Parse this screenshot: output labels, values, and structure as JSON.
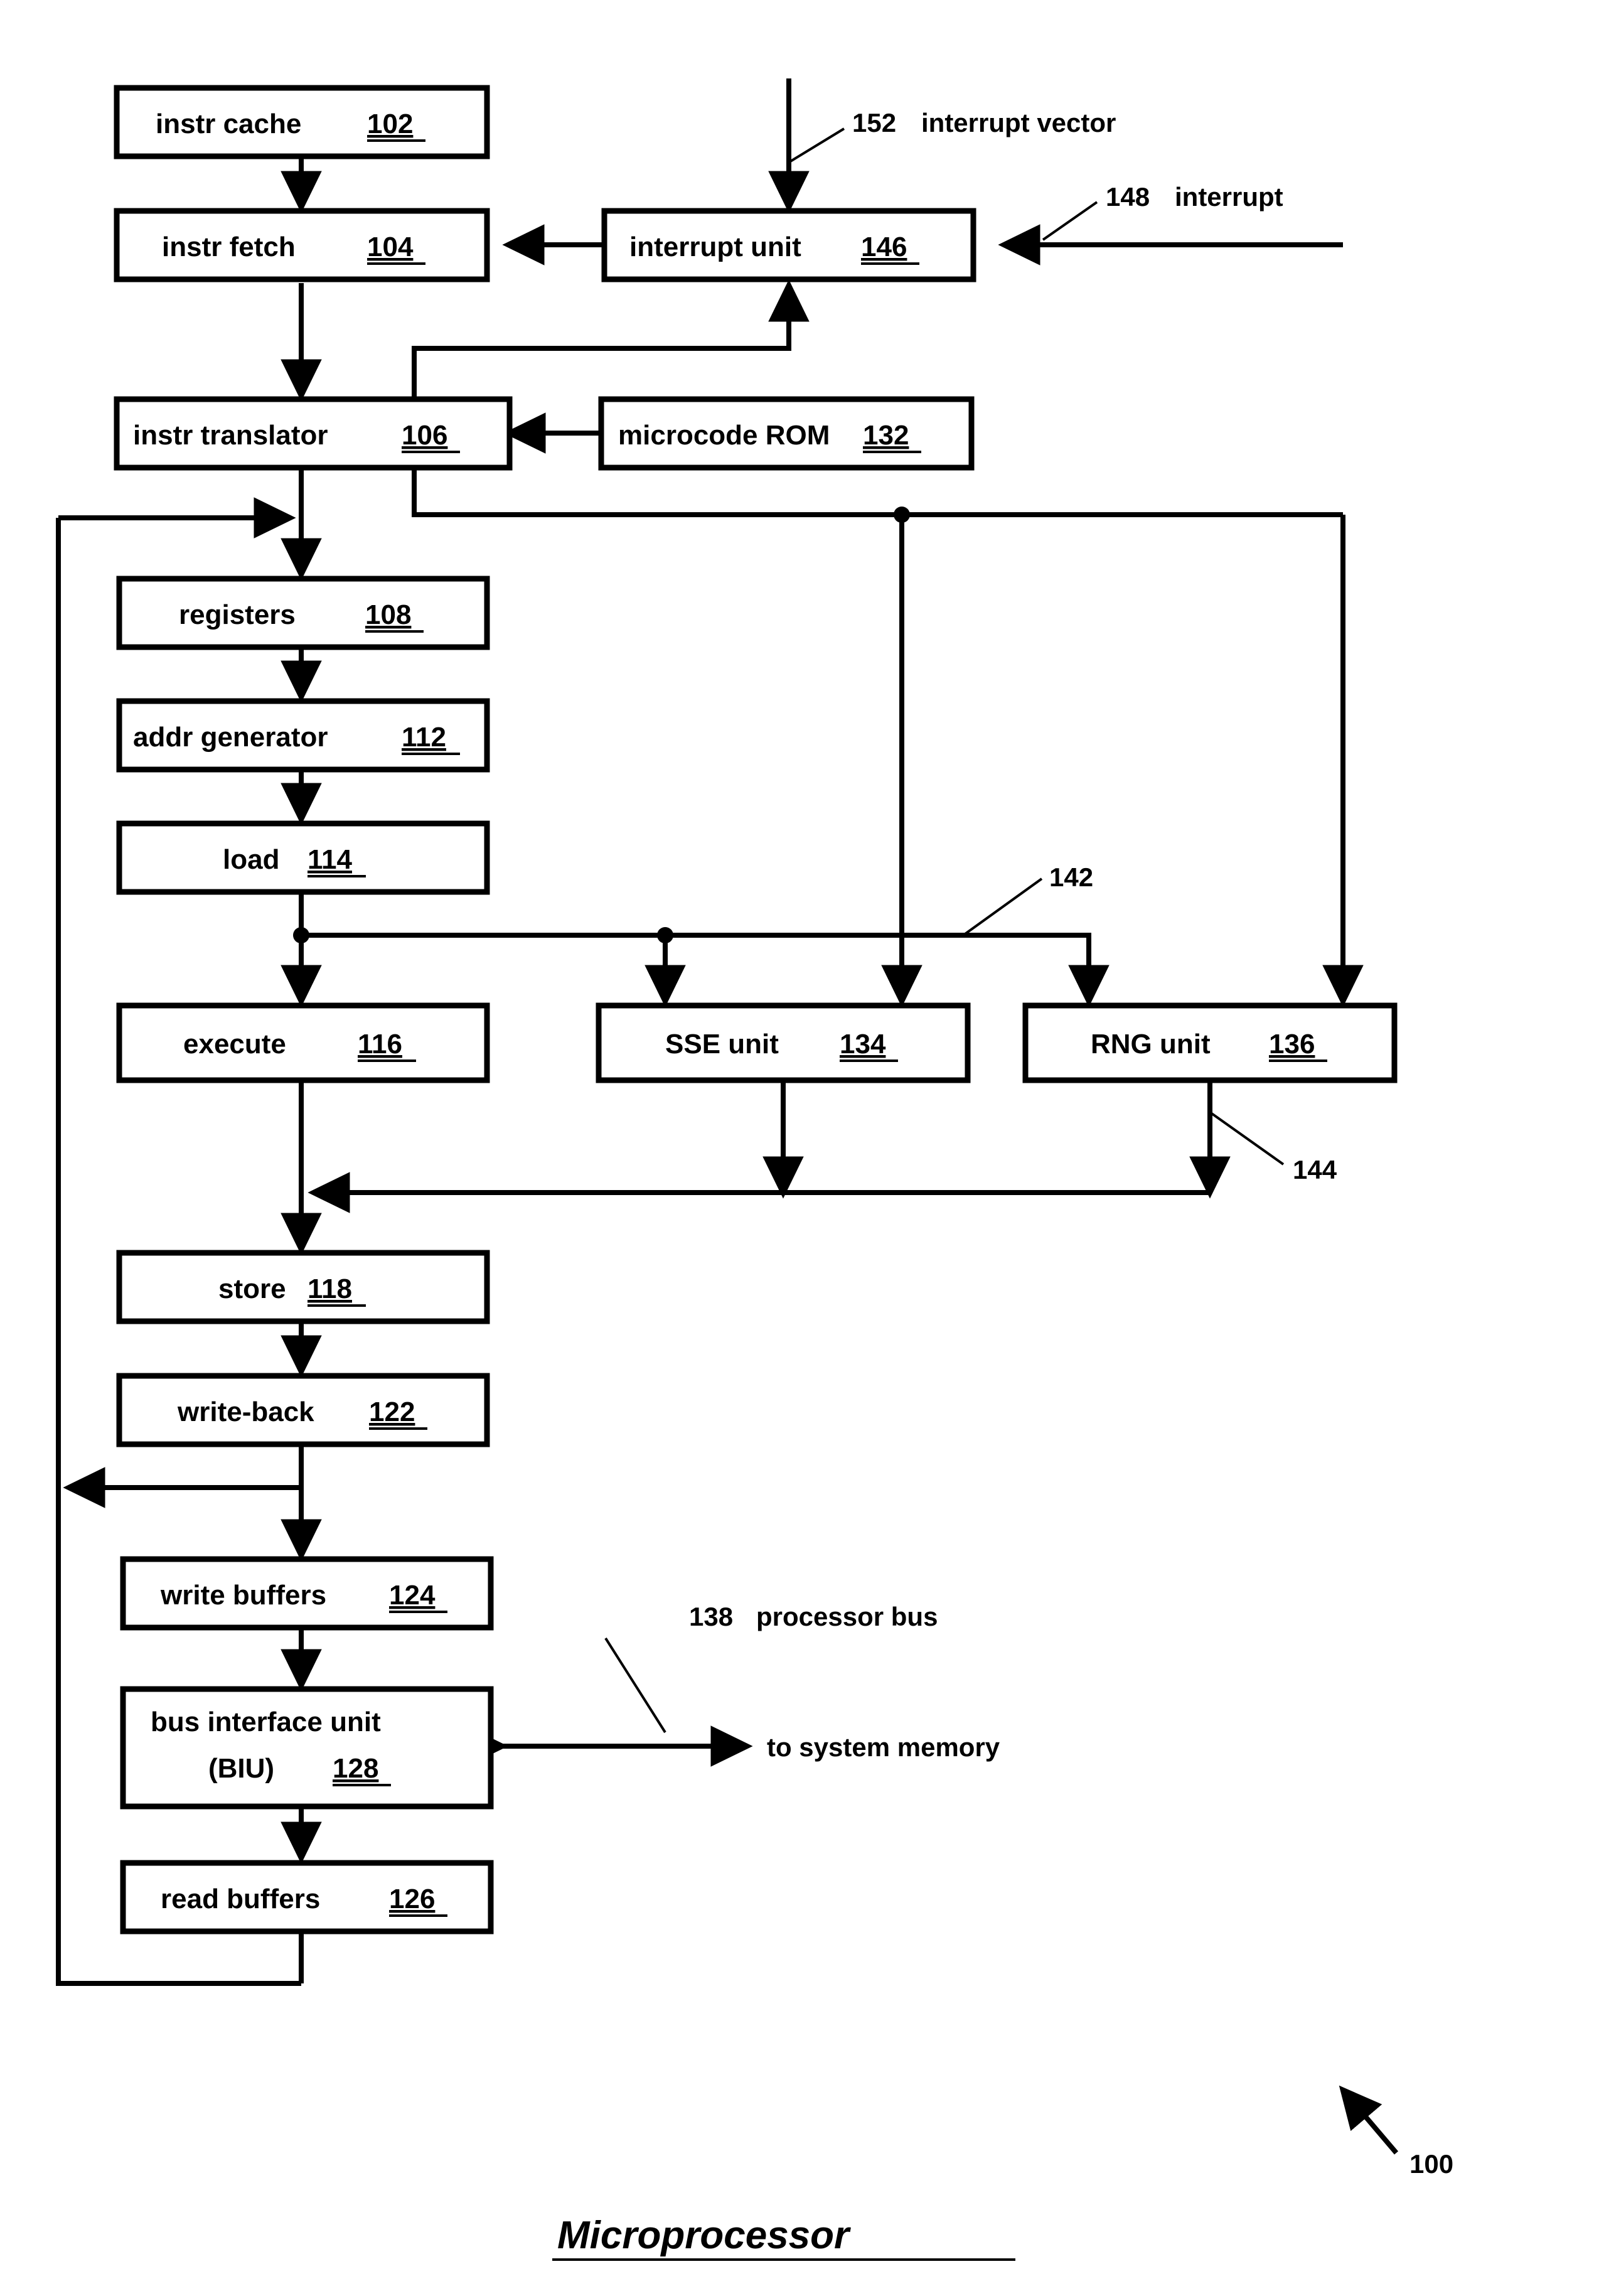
{
  "figure": {
    "title": "Microprocessor",
    "figure_ref": "100"
  },
  "blocks": [
    {
      "id": "instr-cache",
      "label": "instr cache",
      "num": "102"
    },
    {
      "id": "instr-fetch",
      "label": "instr fetch",
      "num": "104"
    },
    {
      "id": "interrupt-unit",
      "label": "interrupt unit",
      "num": "146"
    },
    {
      "id": "instr-translator",
      "label": "instr translator",
      "num": "106"
    },
    {
      "id": "microcode-rom",
      "label": "microcode ROM",
      "num": "132"
    },
    {
      "id": "registers",
      "label": "registers",
      "num": "108"
    },
    {
      "id": "addr-generator",
      "label": "addr generator",
      "num": "112"
    },
    {
      "id": "load",
      "label": "load",
      "num": "114"
    },
    {
      "id": "execute",
      "label": "execute",
      "num": "116"
    },
    {
      "id": "sse-unit",
      "label": "SSE unit",
      "num": "134"
    },
    {
      "id": "rng-unit",
      "label": "RNG unit",
      "num": "136"
    },
    {
      "id": "store",
      "label": "store",
      "num": "118"
    },
    {
      "id": "write-back",
      "label": "write-back",
      "num": "122"
    },
    {
      "id": "write-buffers",
      "label": "write buffers",
      "num": "124"
    },
    {
      "id": "bus-interface-unit",
      "label": "bus interface unit",
      "label2": "(BIU)",
      "num": "128"
    },
    {
      "id": "read-buffers",
      "label": "read buffers",
      "num": "126"
    }
  ],
  "annotations": [
    {
      "id": "interrupt-vector",
      "num": "152",
      "text": "interrupt vector"
    },
    {
      "id": "interrupt",
      "num": "148",
      "text": "interrupt"
    },
    {
      "id": "signal-142",
      "num": "142",
      "text": ""
    },
    {
      "id": "signal-144",
      "num": "144",
      "text": ""
    },
    {
      "id": "processor-bus",
      "num": "138",
      "text": "processor bus"
    },
    {
      "id": "system-memory",
      "num": "",
      "text": "to system memory"
    }
  ],
  "colors": {
    "line": "#000000",
    "box_fill": "#ffffff",
    "background": "#ffffff"
  }
}
